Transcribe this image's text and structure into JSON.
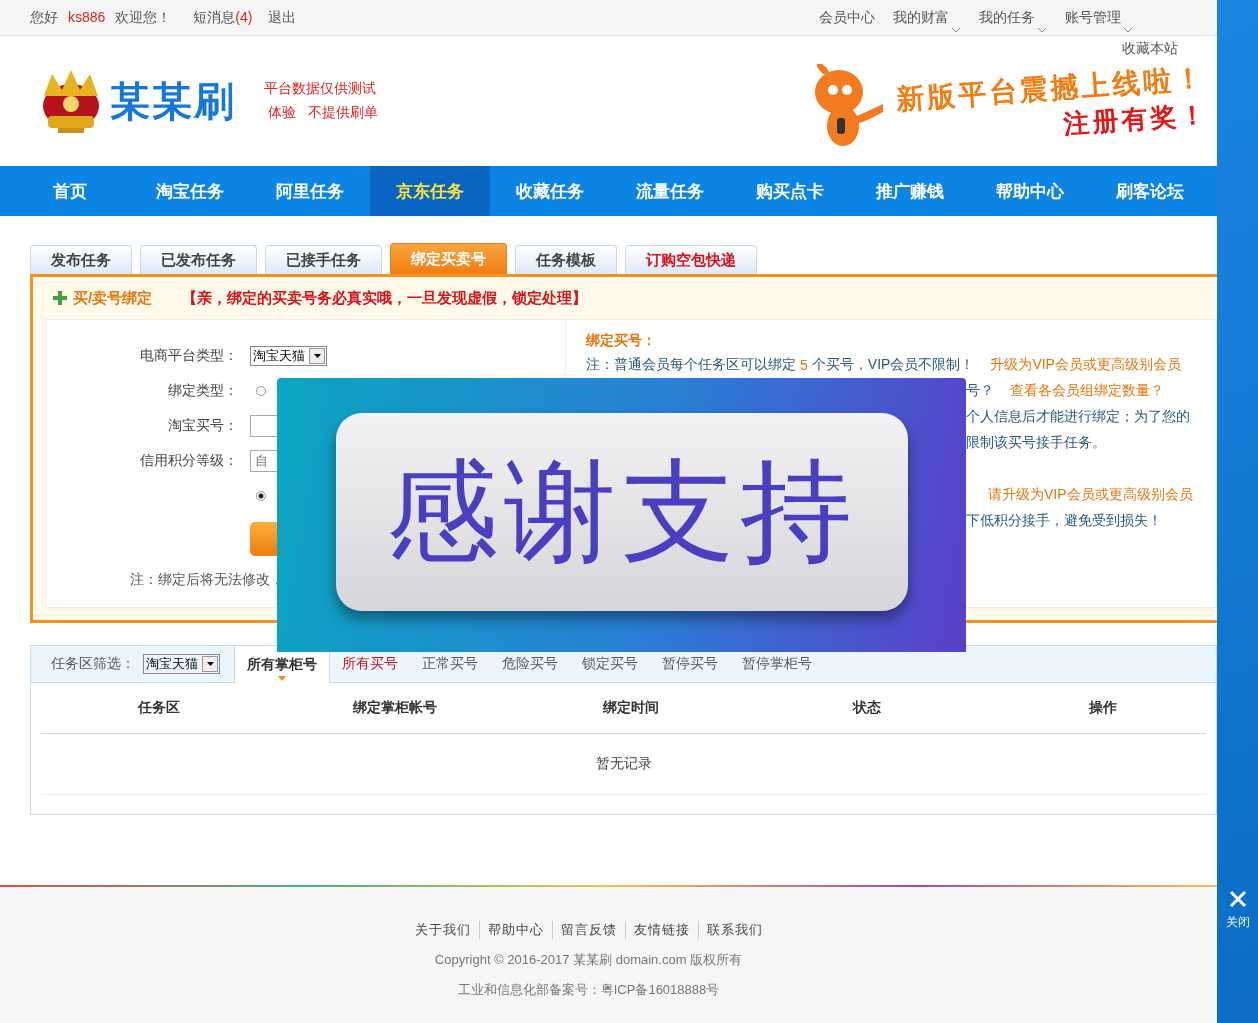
{
  "top_bar": {
    "greeting": "您好",
    "username": "ks886",
    "welcome": "欢迎您！",
    "messages_label": "短消息",
    "messages_count": "(4)",
    "logout": "退出",
    "menu": [
      {
        "label": "会员中心",
        "dropdown": false
      },
      {
        "label": "我的财富",
        "dropdown": true
      },
      {
        "label": "我的任务",
        "dropdown": true
      },
      {
        "label": "账号管理",
        "dropdown": true
      }
    ],
    "bookmark": "收藏本站"
  },
  "header": {
    "logo_text": "某某刷",
    "slogan": [
      "平台数据仅供测试",
      "体验   不提供刷单"
    ],
    "banner_headline": "新版平台震撼上线啦！",
    "banner_subline": "注册有奖！"
  },
  "nav": [
    {
      "label": "首页",
      "selected": false
    },
    {
      "label": "淘宝任务",
      "selected": false
    },
    {
      "label": "阿里任务",
      "selected": false
    },
    {
      "label": "京东任务",
      "selected": true
    },
    {
      "label": "收藏任务",
      "selected": false
    },
    {
      "label": "流量任务",
      "selected": false
    },
    {
      "label": "购买点卡",
      "selected": false
    },
    {
      "label": "推广赚钱",
      "selected": false
    },
    {
      "label": "帮助中心",
      "selected": false
    },
    {
      "label": "刷客论坛",
      "selected": false
    }
  ],
  "tabs": [
    {
      "label": "发布任务",
      "selected": false,
      "kind": "normal"
    },
    {
      "label": "已发布任务",
      "selected": false,
      "kind": "normal"
    },
    {
      "label": "已接手任务",
      "selected": false,
      "kind": "normal"
    },
    {
      "label": "绑定买卖号",
      "selected": true,
      "kind": "normal"
    },
    {
      "label": "任务模板",
      "selected": false,
      "kind": "normal"
    },
    {
      "label": "订购空包快递",
      "selected": false,
      "kind": "promo"
    }
  ],
  "bind_panel": {
    "title": "买/卖号绑定",
    "notice": "【亲，绑定的买卖号务必真实哦，一旦发现虚假，锁定处理】",
    "form": [
      {
        "kind": "select",
        "label": "电商平台类型：",
        "value": "淘宝天猫"
      },
      {
        "kind": "radio",
        "label": "绑定类型：",
        "checked": false
      },
      {
        "kind": "input",
        "label": "淘宝买号："
      },
      {
        "kind": "input",
        "label": "信用积分等级：",
        "placeholder": "自"
      },
      {
        "kind": "radio",
        "checked": true
      },
      {
        "kind": "button"
      }
    ],
    "note": "注：绑定后将无法修改，",
    "info_title": "绑定买号：",
    "info_lines": [
      {
        "parts": [
          {
            "kind": "plain",
            "text": "注：普通会员每个任务区可以绑定"
          },
          {
            "kind": "accent",
            "text": "5"
          },
          {
            "kind": "plain",
            "text": "个买号，VIP会员不限制！"
          },
          {
            "kind": "link",
            "text": "升级为VIP会员或更高级别会员"
          }
        ]
      },
      {
        "parts": [
          {
            "kind": "plain",
            "text": "号？"
          },
          {
            "kind": "link",
            "text": "查看各会员组绑定数量？"
          }
        ]
      },
      {
        "parts": [
          {
            "kind": "plain",
            "text": "个人信息后才能进行绑定；为了您的"
          }
        ]
      },
      {
        "parts": [
          {
            "kind": "plain",
            "text": "限制该买号接手任务。"
          }
        ]
      },
      {
        "parts": [
          {
            "kind": "link",
            "text": "请升级为VIP会员或更高级别会员"
          }
        ]
      },
      {
        "parts": [
          {
            "kind": "plain",
            "text": "下低积分接手，避免受到损失！"
          }
        ]
      }
    ]
  },
  "overlay": {
    "text": "感谢支持"
  },
  "list_section": {
    "filter_label": "任务区筛选：",
    "filter_value": "淘宝天猫",
    "subtabs": [
      {
        "label": "所有掌柜号",
        "selected": true,
        "highlight": false
      },
      {
        "label": "所有买号",
        "selected": false,
        "highlight": true
      },
      {
        "label": "正常买号",
        "selected": false,
        "highlight": false
      },
      {
        "label": "危险买号",
        "selected": false,
        "highlight": false
      },
      {
        "label": "锁定买号",
        "selected": false,
        "highlight": false
      },
      {
        "label": "暂停买号",
        "selected": false,
        "highlight": false
      },
      {
        "label": "暂停掌柜号",
        "selected": false,
        "highlight": false
      }
    ],
    "columns": [
      "任务区",
      "绑定掌柜帐号",
      "绑定时间",
      "状态",
      "操作"
    ],
    "empty_text": "暂无记录"
  },
  "footer": {
    "links": [
      "关于我们",
      "帮助中心",
      "留言反馈",
      "友情链接",
      "联系我们"
    ],
    "copyright": "Copyright © 2016-2017 某某刷  domain.com 版权所有",
    "icp": "工业和信息化部备案号：粤ICP备16018888号"
  },
  "side_panel": {
    "close_label": "关闭"
  }
}
